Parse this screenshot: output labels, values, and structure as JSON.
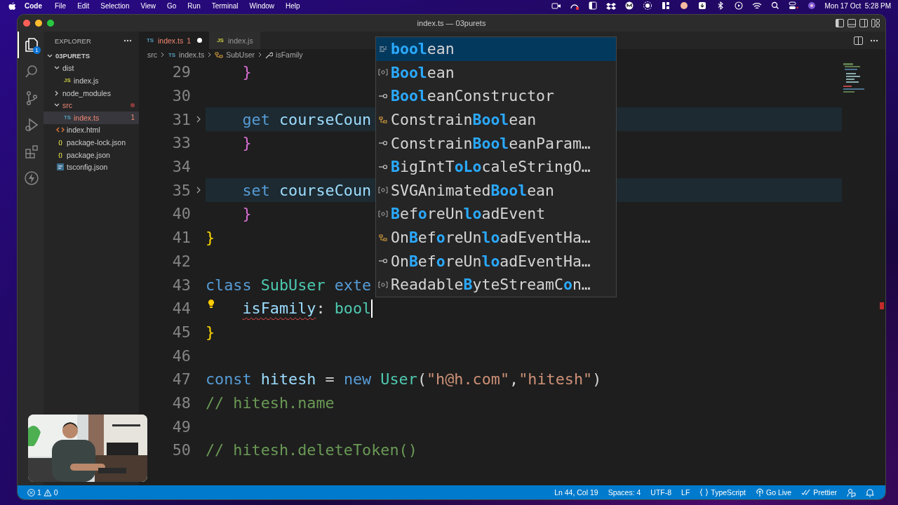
{
  "menubar": {
    "app": "Code",
    "menus": [
      "File",
      "Edit",
      "Selection",
      "View",
      "Go",
      "Run",
      "Terminal",
      "Window",
      "Help"
    ],
    "clock": "Mon 17 Oct  5:28 PM"
  },
  "window": {
    "title": "index.ts — 03purets"
  },
  "activity_bar": [
    {
      "kind": "files",
      "selected": true,
      "badge": "1"
    },
    {
      "kind": "search",
      "selected": false
    },
    {
      "kind": "source-control",
      "selected": false
    },
    {
      "kind": "run-debug",
      "selected": false
    },
    {
      "kind": "extensions",
      "selected": false
    },
    {
      "kind": "lightning",
      "selected": false
    }
  ],
  "explorer": {
    "title": "EXPLORER",
    "tree": {
      "label": "03PURETS",
      "kind": "folder",
      "expanded": true,
      "selected": false,
      "error": false,
      "children": [
        {
          "label": "dist",
          "kind": "folder",
          "expanded": true,
          "selected": false,
          "error": false,
          "children": [
            {
              "label": "index.js",
              "kind": "js",
              "icon": "JS",
              "selected": false,
              "error": false
            }
          ]
        },
        {
          "label": "node_modules",
          "kind": "folder",
          "expanded": false,
          "selected": false,
          "error": false
        },
        {
          "label": "src",
          "kind": "folder",
          "expanded": true,
          "selected": false,
          "error": true,
          "children": [
            {
              "label": "index.ts",
              "kind": "ts",
              "icon": "TS",
              "badge": "1",
              "selected": true,
              "error": true
            }
          ]
        },
        {
          "label": "index.html",
          "kind": "html",
          "selected": false,
          "error": false
        },
        {
          "label": "package-lock.json",
          "kind": "json",
          "icon": "{}",
          "selected": false,
          "error": false
        },
        {
          "label": "package.json",
          "kind": "json",
          "icon": "{}",
          "selected": false,
          "error": false
        },
        {
          "label": "tsconfig.json",
          "kind": "tsconfig",
          "selected": false,
          "error": false
        }
      ]
    }
  },
  "tabs": [
    {
      "label": "index.ts",
      "icon": "TS",
      "kind": "ts",
      "badge": "1",
      "modified": true,
      "error": true,
      "selected": true
    },
    {
      "label": "index.js",
      "icon": "JS",
      "kind": "js",
      "modified": false,
      "error": false,
      "selected": false
    }
  ],
  "breadcrumb": [
    {
      "label": "src",
      "kind": "folder"
    },
    {
      "label": "index.ts",
      "kind": "ts",
      "icon": "TS"
    },
    {
      "label": "SubUser",
      "kind": "class"
    },
    {
      "label": "isFamily",
      "kind": "property"
    }
  ],
  "code": {
    "lines": [
      {
        "number": "29",
        "folded": false,
        "lightbulb": false,
        "cursor": false,
        "tokens": [
          {
            "text": "    }",
            "kind": "brace-pink"
          }
        ]
      },
      {
        "number": "30",
        "folded": false,
        "lightbulb": false,
        "cursor": false
      },
      {
        "number": "31",
        "folded": true,
        "lightbulb": false,
        "cursor": false,
        "tokens": [
          {
            "text": "    get",
            "kind": "keyword"
          },
          {
            "text": " courseCoun",
            "kind": "member"
          }
        ]
      },
      {
        "number": "33",
        "folded": false,
        "lightbulb": false,
        "cursor": false,
        "tokens": [
          {
            "text": "    }",
            "kind": "brace-pink"
          }
        ]
      },
      {
        "number": "34",
        "folded": false,
        "lightbulb": false,
        "cursor": false
      },
      {
        "number": "35",
        "folded": true,
        "lightbulb": false,
        "cursor": false,
        "tokens": [
          {
            "text": "    set",
            "kind": "keyword"
          },
          {
            "text": " courseCoun",
            "kind": "member"
          }
        ]
      },
      {
        "number": "40",
        "folded": false,
        "lightbulb": false,
        "cursor": false,
        "tokens": [
          {
            "text": "    }",
            "kind": "brace-pink"
          }
        ]
      },
      {
        "number": "41",
        "folded": false,
        "lightbulb": false,
        "cursor": false,
        "tokens": [
          {
            "text": "}",
            "kind": "brace-gold"
          }
        ]
      },
      {
        "number": "42",
        "folded": false,
        "lightbulb": false,
        "cursor": false
      },
      {
        "number": "43",
        "folded": false,
        "lightbulb": false,
        "cursor": false,
        "tokens": [
          {
            "text": "class",
            "kind": "keyword"
          },
          {
            "text": " SubUser",
            "kind": "type"
          },
          {
            "text": " exte",
            "kind": "keyword"
          }
        ]
      },
      {
        "number": "44",
        "folded": false,
        "lightbulb": true,
        "cursor": true,
        "tokens": [
          {
            "text": "    isFamily",
            "kind": "member-error"
          },
          {
            "text": ": ",
            "kind": "plain"
          },
          {
            "text": "bool",
            "kind": "type"
          }
        ]
      },
      {
        "number": "45",
        "folded": false,
        "lightbulb": false,
        "cursor": false,
        "tokens": [
          {
            "text": "}",
            "kind": "brace-gold"
          }
        ]
      },
      {
        "number": "46",
        "folded": false,
        "lightbulb": false,
        "cursor": false
      },
      {
        "number": "47",
        "folded": false,
        "lightbulb": false,
        "cursor": false,
        "tokens": [
          {
            "text": "const",
            "kind": "keyword"
          },
          {
            "text": " hitesh",
            "kind": "member"
          },
          {
            "text": " = ",
            "kind": "plain"
          },
          {
            "text": "new",
            "kind": "keyword"
          },
          {
            "text": " User",
            "kind": "type"
          },
          {
            "text": "(",
            "kind": "plain"
          },
          {
            "text": "\"h@h.com\"",
            "kind": "string"
          },
          {
            "text": ",",
            "kind": "plain"
          },
          {
            "text": "\"hitesh\"",
            "kind": "string"
          },
          {
            "text": ")",
            "kind": "plain"
          }
        ]
      },
      {
        "number": "48",
        "folded": false,
        "lightbulb": false,
        "cursor": false,
        "tokens": [
          {
            "text": "// hitesh.name",
            "kind": "comment"
          }
        ]
      },
      {
        "number": "49",
        "folded": false,
        "lightbulb": false,
        "cursor": false
      },
      {
        "number": "50",
        "folded": false,
        "lightbulb": false,
        "cursor": false,
        "tokens": [
          {
            "text": "// hitesh.deleteToken()",
            "kind": "comment"
          }
        ]
      }
    ]
  },
  "suggestions": [
    {
      "label": "**bool**ean",
      "kind": "keyword",
      "selected": true
    },
    {
      "label": "**Bool**ean",
      "kind": "variable",
      "selected": false
    },
    {
      "label": "**Bool**eanConstructor",
      "kind": "interface",
      "selected": false
    },
    {
      "label": "Constrain**Bool**ean",
      "kind": "type-parameter",
      "selected": false
    },
    {
      "label": "Constrain**Bool**eanParam…",
      "kind": "interface",
      "selected": false
    },
    {
      "label": "**B**igIntT**oLo**caleStringO…",
      "kind": "interface",
      "selected": false
    },
    {
      "label": "SVGAnimated**Bool**ean",
      "kind": "variable",
      "selected": false
    },
    {
      "label": "**B**ef**o**reUn**lo**adEvent",
      "kind": "variable",
      "selected": false
    },
    {
      "label": "On**B**ef**o**reUn**lo**adEventHa…",
      "kind": "type-parameter",
      "selected": false
    },
    {
      "label": "On**B**ef**o**reUn**lo**adEventHa…",
      "kind": "interface",
      "selected": false
    },
    {
      "label": "Readable**B**yteStreamC**o**n…",
      "kind": "variable",
      "selected": false
    }
  ],
  "status_bar": {
    "errors": "1",
    "warnings": "0",
    "items": [
      {
        "kind": "text",
        "text": "Ln 44, Col 19"
      },
      {
        "kind": "text",
        "text": "Spaces: 4"
      },
      {
        "kind": "text",
        "text": "UTF-8"
      },
      {
        "kind": "text",
        "text": "LF"
      },
      {
        "kind": "language",
        "text": "TypeScript"
      },
      {
        "kind": "go-live",
        "text": "Go Live"
      },
      {
        "kind": "prettier",
        "text": "Prettier"
      },
      {
        "kind": "feedback"
      },
      {
        "kind": "bell"
      }
    ]
  }
}
